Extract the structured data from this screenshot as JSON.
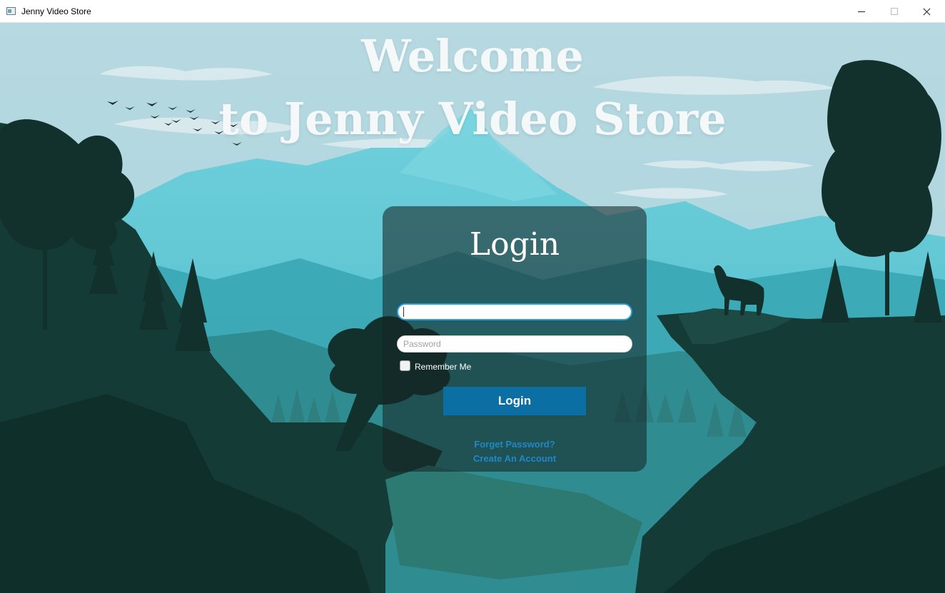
{
  "window": {
    "title": "Jenny Video Store",
    "controls": {
      "minimize": "minimize",
      "maximize": "maximize",
      "close": "close"
    }
  },
  "hero": {
    "line1": "Welcome",
    "line2": "to Jenny Video Store"
  },
  "login": {
    "title": "Login",
    "username": {
      "value": "",
      "placeholder": ""
    },
    "password": {
      "value": "",
      "placeholder": "Password"
    },
    "remember_label": "Remember Me",
    "button_label": "Login",
    "forgot_label": "Forget Password?",
    "create_label": "Create An Account"
  },
  "colors": {
    "login_button": "#0b6fa4",
    "link": "#1e88c9",
    "sky": "#b5d8e0",
    "forest": "#173f39"
  }
}
